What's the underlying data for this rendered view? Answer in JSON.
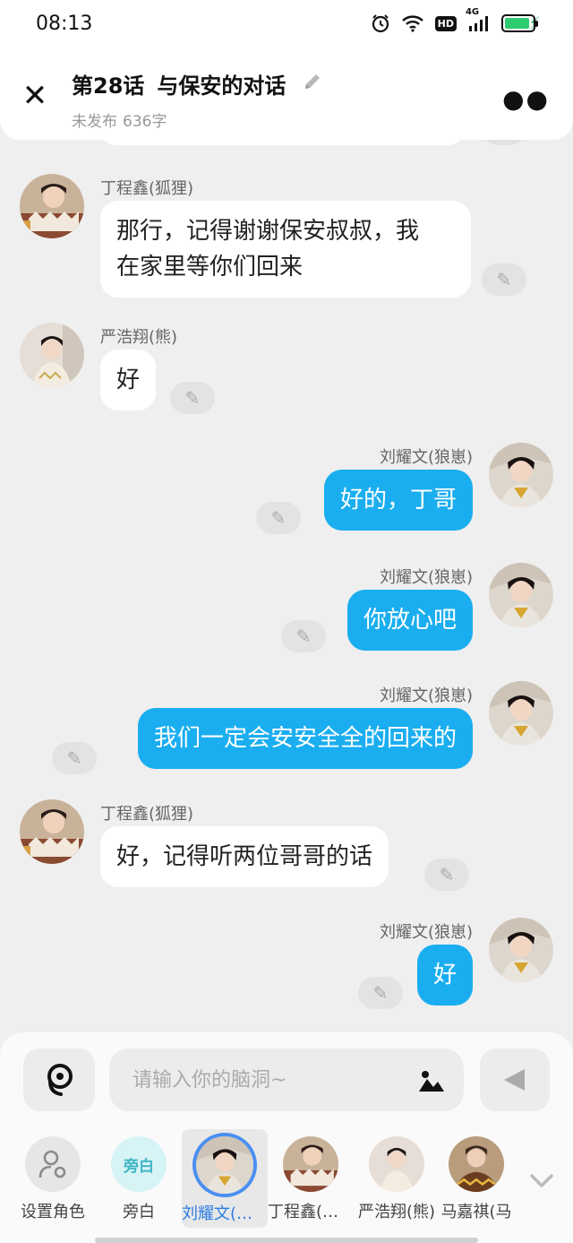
{
  "status_bar": {
    "time": "08:13",
    "network_type": "4G",
    "hd_label": "HD",
    "battery_level": 0.9
  },
  "header": {
    "chapter": "第28话",
    "title": "与保安的对话",
    "status": "未发布",
    "word_count": "636字"
  },
  "messages": [
    {
      "side": "left",
      "sender": "丁程鑫(狐狸)",
      "lines": [
        "那行，记得谢谢保安叔叔，我",
        "在家里等你们回来"
      ],
      "avatar": "dingchengxin"
    },
    {
      "side": "left",
      "sender": "严浩翔(熊)",
      "lines": [
        "好"
      ],
      "avatar": "yanhaoxiang"
    },
    {
      "side": "right",
      "sender": "刘耀文(狼崽)",
      "lines": [
        "好的，丁哥"
      ],
      "avatar": "liuyaowen"
    },
    {
      "side": "right",
      "sender": "刘耀文(狼崽)",
      "lines": [
        "你放心吧"
      ],
      "avatar": "liuyaowen"
    },
    {
      "side": "right",
      "sender": "刘耀文(狼崽)",
      "lines": [
        "我们一定会安安全全的回来的"
      ],
      "avatar": "liuyaowen"
    },
    {
      "side": "left",
      "sender": "丁程鑫(狐狸)",
      "lines": [
        "好，记得听两位哥哥的话"
      ],
      "avatar": "dingchengxin"
    },
    {
      "side": "right",
      "sender": "刘耀文(狼崽)",
      "lines": [
        "好"
      ],
      "avatar": "liuyaowen"
    }
  ],
  "input": {
    "placeholder": "请输入你的脑洞~"
  },
  "roles": [
    {
      "name": "设置角色",
      "kind": "settings",
      "icon": "user-settings-icon"
    },
    {
      "name": "旁白",
      "kind": "narration",
      "badge": "旁白"
    },
    {
      "name": "刘耀文(狼崽)",
      "display": "刘耀文(狼...",
      "kind": "avatar",
      "selected": true,
      "avatar": "liuyaowen"
    },
    {
      "name": "丁程鑫(狐狸)",
      "display": "丁程鑫(狐...",
      "kind": "avatar",
      "avatar": "dingchengxin"
    },
    {
      "name": "严浩翔(熊)",
      "display": "严浩翔(熊)",
      "kind": "avatar",
      "avatar": "yanhaoxiang"
    },
    {
      "name": "马嘉祺(马",
      "display": "马嘉祺(马",
      "kind": "avatar",
      "avatar": "majiaqi"
    }
  ],
  "colors": {
    "right_bubble": "#1aaef0",
    "left_bubble": "#ffffff",
    "background": "#efefef",
    "selected_role": "#2c7be5"
  }
}
